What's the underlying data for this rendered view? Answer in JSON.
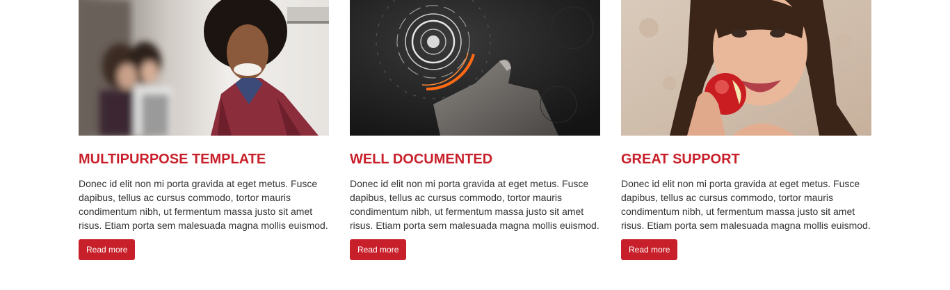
{
  "colors": {
    "accent": "#c8202a",
    "body_text": "#333333",
    "background": "#ffffff"
  },
  "features": [
    {
      "title": "MULTIPURPOSE TEMPLATE",
      "image": "photo-smiling-man-red-jacket",
      "text": "Donec id elit non mi porta gravida at eget metus. Fusce dapibus, tellus ac cursus commodo, tortor mauris condimentum nibh, ut fermentum massa justo sit amet risus. Etiam porta sem malesuada magna mollis euismod.",
      "button_label": "Read more"
    },
    {
      "title": "WELL DOCUMENTED",
      "image": "photo-hand-touch-interface",
      "text": "Donec id elit non mi porta gravida at eget metus. Fusce dapibus, tellus ac cursus commodo, tortor mauris condimentum nibh, ut fermentum massa justo sit amet risus. Etiam porta sem malesuada magna mollis euismod.",
      "button_label": "Read more"
    },
    {
      "title": "GREAT SUPPORT",
      "image": "photo-woman-eating-apple",
      "text": "Donec id elit non mi porta gravida at eget metus. Fusce dapibus, tellus ac cursus commodo, tortor mauris condimentum nibh, ut fermentum massa justo sit amet risus. Etiam porta sem malesuada magna mollis euismod.",
      "button_label": "Read more"
    }
  ]
}
